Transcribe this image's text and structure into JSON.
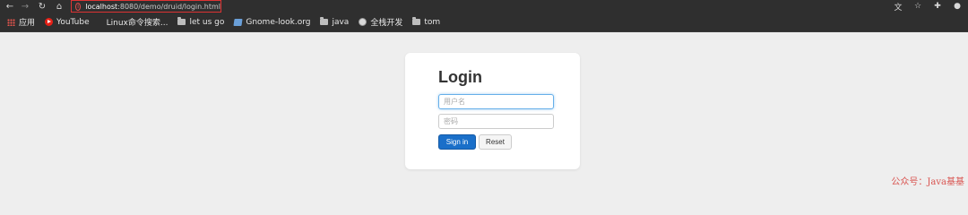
{
  "browser": {
    "url_host": "localhost",
    "url_rest": ":8080/demo/druid/login.html",
    "nav_icons": {
      "back": "arrow-left-icon",
      "forward": "arrow-right-icon",
      "reload": "reload-icon",
      "home": "home-icon",
      "info": "info-icon"
    },
    "right_icons": [
      "translate-icon",
      "star-icon",
      "extensions-icon",
      "account-icon"
    ]
  },
  "bookmarks": {
    "items": [
      {
        "label": "应用",
        "icon": "apps-icon"
      },
      {
        "label": "YouTube",
        "icon": "youtube-icon"
      },
      {
        "label": "Linux命令搜索...",
        "icon": ""
      },
      {
        "label": "let us go",
        "icon": "folder-icon"
      },
      {
        "label": "Gnome-look.org",
        "icon": "gnome-icon"
      },
      {
        "label": "java",
        "icon": "folder-icon"
      },
      {
        "label": "全栈开发",
        "icon": "globe-icon"
      },
      {
        "label": "tom",
        "icon": "folder-icon"
      }
    ]
  },
  "login": {
    "title": "Login",
    "username_placeholder": "用户名",
    "password_placeholder": "密码",
    "signin_label": "Sign in",
    "reset_label": "Reset"
  },
  "watermark": "公众号：Java基基",
  "colors": {
    "primary_button": "#1a6fc9",
    "browser_bar": "#2f2f2f",
    "page_background": "#eeeeee",
    "watermark": "#d9534f",
    "url_highlight_border": "#dd3333"
  }
}
